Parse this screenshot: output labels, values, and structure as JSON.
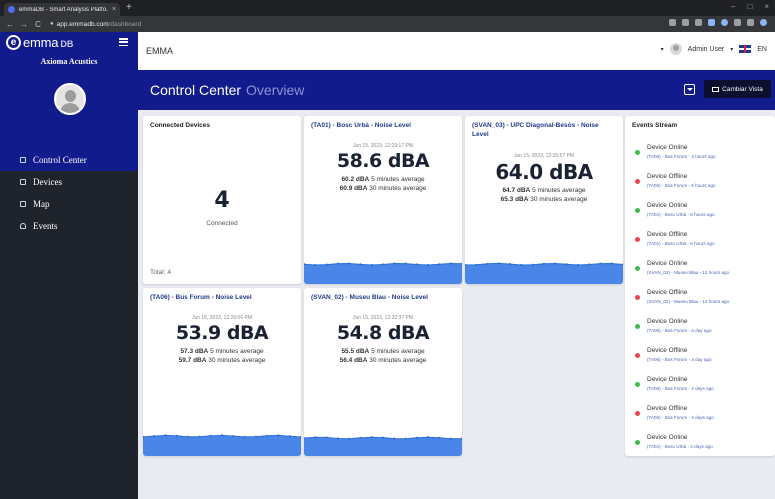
{
  "browser": {
    "tab_title": "emmaDB - Smart Analysis Platfo...",
    "tab_close": "×",
    "new_tab": "+",
    "url_host": "app.emmadb.com",
    "url_path": "/dashboard",
    "nav_back": "←",
    "nav_forward": "→",
    "nav_reload": "C",
    "win_min": "–",
    "win_max": "□",
    "win_close": "×"
  },
  "sidebar": {
    "logo_letter": "e",
    "logo_text": "emma",
    "logo_suffix": "DB",
    "org_name": "Axioma Acustics",
    "items": [
      {
        "label": "Control Center",
        "icon": "grid-icon",
        "active": true
      },
      {
        "label": "Devices",
        "icon": "devices-icon",
        "active": false
      },
      {
        "label": "Map",
        "icon": "map-icon",
        "active": false
      },
      {
        "label": "Events",
        "icon": "bell-icon",
        "active": false
      }
    ]
  },
  "header": {
    "title": "EMMA",
    "user": "Admin User",
    "lang": "EN",
    "caret": "▾"
  },
  "hero": {
    "title": "Control Center",
    "subtitle": "Overview",
    "view_button": "Cambiar Vista"
  },
  "cards": {
    "connected": {
      "title": "Connected Devices",
      "count": "4",
      "label": "Connected",
      "total": "Total: 4"
    },
    "devices": [
      {
        "title": "(TA01) - Bosc Urbà - Noise Level",
        "timestamp": "Jun 15, 2023, 12:29:17 PM",
        "value": "58.6 dBA",
        "avg5_value": "60.2 dBA",
        "avg5_label": "5 minutes average",
        "avg30_value": "60.9 dBA",
        "avg30_label": "30 minutes average",
        "level": 0.55
      },
      {
        "title": "(SVAN_03) - UPC Diagonal-Besòs - Noise Level",
        "timestamp": "Jun 15, 2023, 12:25:57 PM",
        "value": "64.0 dBA",
        "avg5_value": "64.7 dBA",
        "avg5_label": "5 minutes average",
        "avg30_value": "65.3 dBA",
        "avg30_label": "30 minutes average",
        "level": 0.55
      },
      {
        "title": "(TA06) - Bus Forum - Noise Level",
        "timestamp": "Jun 15, 2023, 12:29:06 PM",
        "value": "53.9 dBA",
        "avg5_value": "57.3 dBA",
        "avg5_label": "5 minutes average",
        "avg30_value": "59.7 dBA",
        "avg30_label": "30 minutes average",
        "level": 0.55
      },
      {
        "title": "(SVAN_02) - Museu Blau - Noise Level",
        "timestamp": "Jun 15, 2023, 12:32:37 PM",
        "value": "54.8 dBA",
        "avg5_value": "55.5 dBA",
        "avg5_label": "5 minutes average",
        "avg30_value": "56.4 dBA",
        "avg30_label": "30 minutes average",
        "level": 0.5
      }
    ]
  },
  "events": {
    "title": "Events Stream",
    "items": [
      {
        "status": "Device Online",
        "detail": "(TA06) - Bus Forum - 3 hours ago",
        "color": "#3fb950"
      },
      {
        "status": "Device Offline",
        "detail": "(TA06) - Bus Forum - 6 hours ago",
        "color": "#e5484d"
      },
      {
        "status": "Device Online",
        "detail": "(TA01) - Bosc Urbà - 6 hours ago",
        "color": "#3fb950"
      },
      {
        "status": "Device Offline",
        "detail": "(TA01) - Bosc Urbà - 9 hours ago",
        "color": "#e5484d"
      },
      {
        "status": "Device Online",
        "detail": "(SVAN_02) - Museu Blau - 12 hours ago",
        "color": "#3fb950"
      },
      {
        "status": "Device Offline",
        "detail": "(SVAN_02) - Museu Blau - 12 hours ago",
        "color": "#e5484d"
      },
      {
        "status": "Device Online",
        "detail": "(TA06) - Bus Forum - a day ago",
        "color": "#3fb950"
      },
      {
        "status": "Device Offline",
        "detail": "(TA06) - Bus Forum - a day ago",
        "color": "#e5484d"
      },
      {
        "status": "Device Online",
        "detail": "(TA06) - Bus Forum - 2 days ago",
        "color": "#3fb950"
      },
      {
        "status": "Device Offline",
        "detail": "(TA06) - Bus Forum - 2 days ago",
        "color": "#e5484d"
      },
      {
        "status": "Device Online",
        "detail": "(TA01) - Bosc Urbà - 3 days ago",
        "color": "#3fb950"
      }
    ]
  },
  "colors": {
    "brand_blue": "#121b8c",
    "sidebar_dark": "#1f232b",
    "chart_fill": "#4a86e8",
    "chart_line": "#2f6fd6"
  }
}
